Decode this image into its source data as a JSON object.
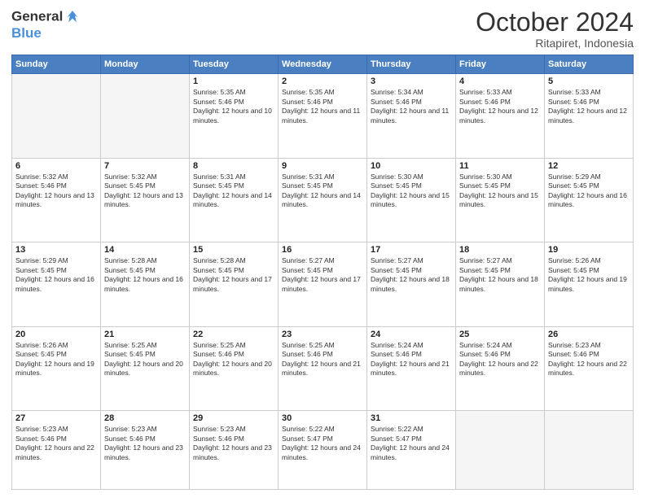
{
  "header": {
    "logo_line1": "General",
    "logo_line2": "Blue",
    "month": "October 2024",
    "location": "Ritapiret, Indonesia"
  },
  "weekdays": [
    "Sunday",
    "Monday",
    "Tuesday",
    "Wednesday",
    "Thursday",
    "Friday",
    "Saturday"
  ],
  "weeks": [
    [
      {
        "day": "",
        "info": ""
      },
      {
        "day": "",
        "info": ""
      },
      {
        "day": "1",
        "info": "Sunrise: 5:35 AM\nSunset: 5:46 PM\nDaylight: 12 hours and 10 minutes."
      },
      {
        "day": "2",
        "info": "Sunrise: 5:35 AM\nSunset: 5:46 PM\nDaylight: 12 hours and 11 minutes."
      },
      {
        "day": "3",
        "info": "Sunrise: 5:34 AM\nSunset: 5:46 PM\nDaylight: 12 hours and 11 minutes."
      },
      {
        "day": "4",
        "info": "Sunrise: 5:33 AM\nSunset: 5:46 PM\nDaylight: 12 hours and 12 minutes."
      },
      {
        "day": "5",
        "info": "Sunrise: 5:33 AM\nSunset: 5:46 PM\nDaylight: 12 hours and 12 minutes."
      }
    ],
    [
      {
        "day": "6",
        "info": "Sunrise: 5:32 AM\nSunset: 5:46 PM\nDaylight: 12 hours and 13 minutes."
      },
      {
        "day": "7",
        "info": "Sunrise: 5:32 AM\nSunset: 5:45 PM\nDaylight: 12 hours and 13 minutes."
      },
      {
        "day": "8",
        "info": "Sunrise: 5:31 AM\nSunset: 5:45 PM\nDaylight: 12 hours and 14 minutes."
      },
      {
        "day": "9",
        "info": "Sunrise: 5:31 AM\nSunset: 5:45 PM\nDaylight: 12 hours and 14 minutes."
      },
      {
        "day": "10",
        "info": "Sunrise: 5:30 AM\nSunset: 5:45 PM\nDaylight: 12 hours and 15 minutes."
      },
      {
        "day": "11",
        "info": "Sunrise: 5:30 AM\nSunset: 5:45 PM\nDaylight: 12 hours and 15 minutes."
      },
      {
        "day": "12",
        "info": "Sunrise: 5:29 AM\nSunset: 5:45 PM\nDaylight: 12 hours and 16 minutes."
      }
    ],
    [
      {
        "day": "13",
        "info": "Sunrise: 5:29 AM\nSunset: 5:45 PM\nDaylight: 12 hours and 16 minutes."
      },
      {
        "day": "14",
        "info": "Sunrise: 5:28 AM\nSunset: 5:45 PM\nDaylight: 12 hours and 16 minutes."
      },
      {
        "day": "15",
        "info": "Sunrise: 5:28 AM\nSunset: 5:45 PM\nDaylight: 12 hours and 17 minutes."
      },
      {
        "day": "16",
        "info": "Sunrise: 5:27 AM\nSunset: 5:45 PM\nDaylight: 12 hours and 17 minutes."
      },
      {
        "day": "17",
        "info": "Sunrise: 5:27 AM\nSunset: 5:45 PM\nDaylight: 12 hours and 18 minutes."
      },
      {
        "day": "18",
        "info": "Sunrise: 5:27 AM\nSunset: 5:45 PM\nDaylight: 12 hours and 18 minutes."
      },
      {
        "day": "19",
        "info": "Sunrise: 5:26 AM\nSunset: 5:45 PM\nDaylight: 12 hours and 19 minutes."
      }
    ],
    [
      {
        "day": "20",
        "info": "Sunrise: 5:26 AM\nSunset: 5:45 PM\nDaylight: 12 hours and 19 minutes."
      },
      {
        "day": "21",
        "info": "Sunrise: 5:25 AM\nSunset: 5:45 PM\nDaylight: 12 hours and 20 minutes."
      },
      {
        "day": "22",
        "info": "Sunrise: 5:25 AM\nSunset: 5:46 PM\nDaylight: 12 hours and 20 minutes."
      },
      {
        "day": "23",
        "info": "Sunrise: 5:25 AM\nSunset: 5:46 PM\nDaylight: 12 hours and 21 minutes."
      },
      {
        "day": "24",
        "info": "Sunrise: 5:24 AM\nSunset: 5:46 PM\nDaylight: 12 hours and 21 minutes."
      },
      {
        "day": "25",
        "info": "Sunrise: 5:24 AM\nSunset: 5:46 PM\nDaylight: 12 hours and 22 minutes."
      },
      {
        "day": "26",
        "info": "Sunrise: 5:23 AM\nSunset: 5:46 PM\nDaylight: 12 hours and 22 minutes."
      }
    ],
    [
      {
        "day": "27",
        "info": "Sunrise: 5:23 AM\nSunset: 5:46 PM\nDaylight: 12 hours and 22 minutes."
      },
      {
        "day": "28",
        "info": "Sunrise: 5:23 AM\nSunset: 5:46 PM\nDaylight: 12 hours and 23 minutes."
      },
      {
        "day": "29",
        "info": "Sunrise: 5:23 AM\nSunset: 5:46 PM\nDaylight: 12 hours and 23 minutes."
      },
      {
        "day": "30",
        "info": "Sunrise: 5:22 AM\nSunset: 5:47 PM\nDaylight: 12 hours and 24 minutes."
      },
      {
        "day": "31",
        "info": "Sunrise: 5:22 AM\nSunset: 5:47 PM\nDaylight: 12 hours and 24 minutes."
      },
      {
        "day": "",
        "info": ""
      },
      {
        "day": "",
        "info": ""
      }
    ]
  ]
}
